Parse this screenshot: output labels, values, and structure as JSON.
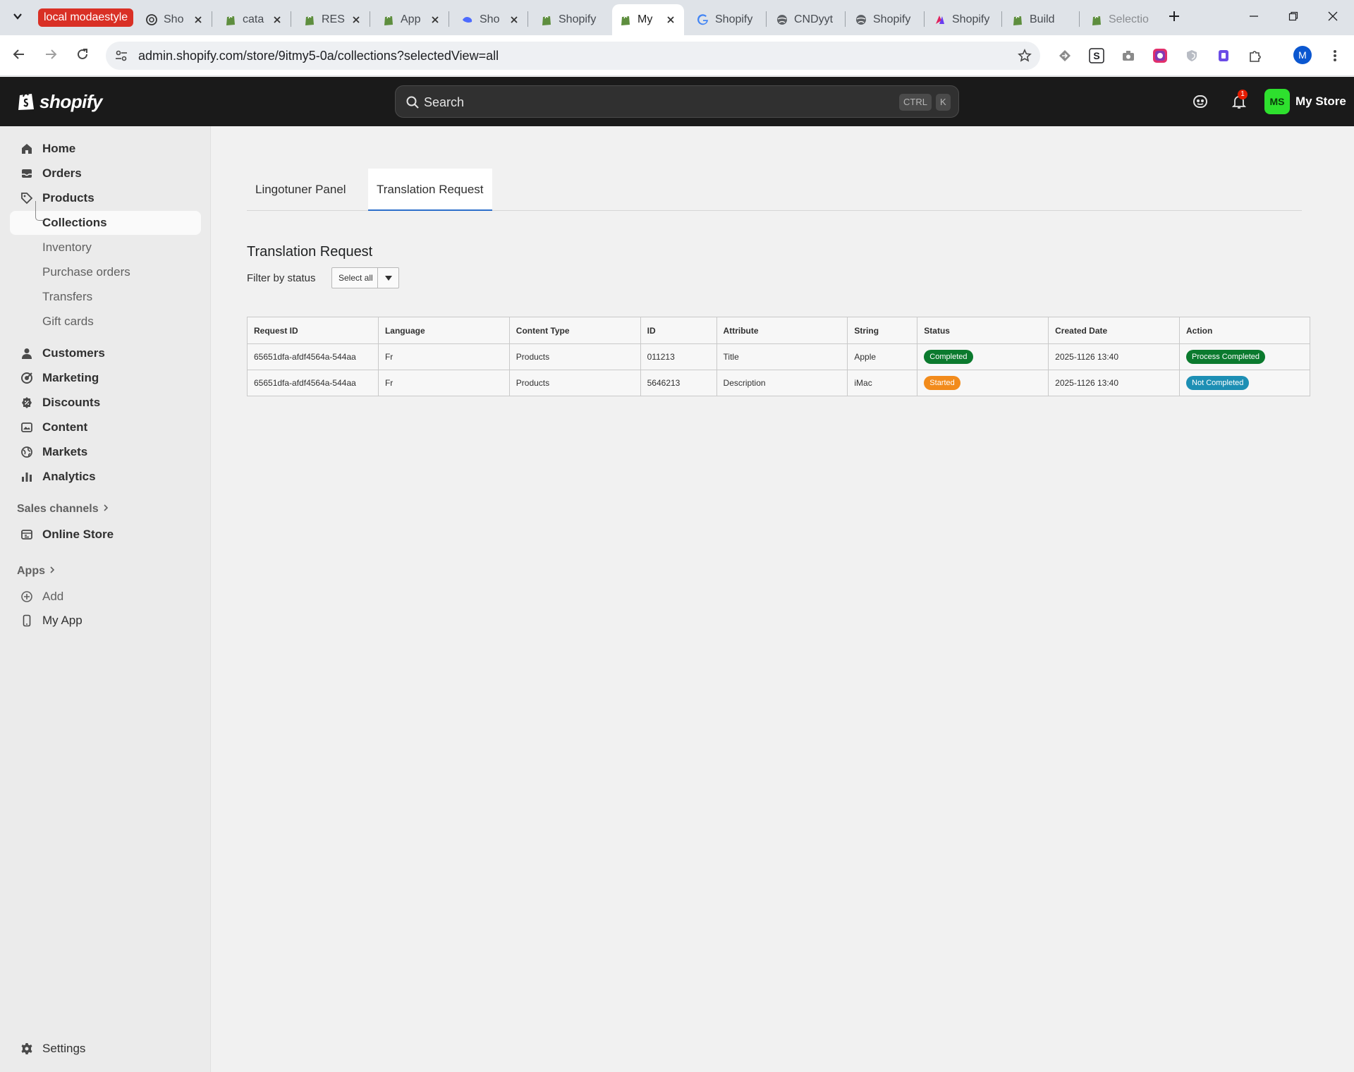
{
  "browser": {
    "tab_group_label": "local modaestyle",
    "tabs": [
      {
        "title": "Sho",
        "icon": "chatgpt-icon"
      },
      {
        "title": "cata",
        "icon": "shopify-bag-icon"
      },
      {
        "title": "RES",
        "icon": "shopify-bag-icon"
      },
      {
        "title": "App",
        "icon": "shopify-bag-icon"
      },
      {
        "title": "Sho",
        "icon": "deepseek-icon"
      },
      {
        "title": "Shopify",
        "icon": "shopify-bag-icon"
      },
      {
        "title": "My",
        "icon": "shopify-bag-icon"
      },
      {
        "title": "Shopify",
        "icon": "google-icon"
      },
      {
        "title": "CNDyyt",
        "icon": "globe-icon"
      },
      {
        "title": "Shopify",
        "icon": "globe-icon"
      },
      {
        "title": "Shopify",
        "icon": "app-icon"
      },
      {
        "title": "Build",
        "icon": "shopify-bag-icon"
      },
      {
        "title": "Selectio",
        "icon": "shopify-bag-icon"
      }
    ],
    "url": "admin.shopify.com/store/9itmy5-0a/collections?selectedView=all",
    "profile_initial": "M"
  },
  "topbar": {
    "logo_text": "shopify",
    "search_placeholder": "Search",
    "shortcut_ctrl": "CTRL",
    "shortcut_key": "K",
    "notification_count": "1",
    "store_initials": "MS",
    "store_name": "My Store"
  },
  "sidebar": {
    "items": [
      {
        "label": "Home",
        "icon": "home-icon"
      },
      {
        "label": "Orders",
        "icon": "inbox-icon"
      },
      {
        "label": "Products",
        "icon": "tag-icon"
      },
      {
        "label": "Collections"
      },
      {
        "label": "Inventory"
      },
      {
        "label": "Purchase orders"
      },
      {
        "label": "Transfers"
      },
      {
        "label": "Gift cards"
      },
      {
        "label": "Customers",
        "icon": "person-icon"
      },
      {
        "label": "Marketing",
        "icon": "target-icon"
      },
      {
        "label": "Discounts",
        "icon": "discount-icon"
      },
      {
        "label": "Content",
        "icon": "content-icon"
      },
      {
        "label": "Markets",
        "icon": "globe-icon"
      },
      {
        "label": "Analytics",
        "icon": "bar-chart-icon"
      }
    ],
    "sales_channels_label": "Sales channels",
    "online_store_label": "Online Store",
    "apps_label": "Apps",
    "add_label": "Add",
    "my_app_label": "My App",
    "settings_label": "Settings"
  },
  "main": {
    "tabs": [
      {
        "label": "Lingotuner Panel"
      },
      {
        "label": "Translation Request"
      }
    ],
    "title": "Translation Request",
    "filter_label": "Filter by status",
    "filter_value": "Select all",
    "table": {
      "headers": [
        "Request ID",
        "Language",
        "Content Type",
        "ID",
        "Attribute",
        "String",
        "Status",
        "Created Date",
        "Action"
      ],
      "rows": [
        {
          "request_id": "65651dfa-afdf4564a-544aa",
          "language": "Fr",
          "content_type": "Products",
          "id": "011213",
          "attribute": "Title",
          "string": "Apple",
          "status": "Completed",
          "created": "2025-1126 13:40",
          "action": "Process Completed"
        },
        {
          "request_id": "65651dfa-afdf4564a-544aa",
          "language": "Fr",
          "content_type": "Products",
          "id": "5646213",
          "attribute": "Description",
          "string": "iMac",
          "status": "Started",
          "created": "2025-1126 13:40",
          "action": "Not Completed"
        }
      ]
    }
  },
  "colors": {
    "completed_badge": "#0b7a2e",
    "started_badge": "#f28b1b",
    "process_completed_badge": "#0b7a2e",
    "not_completed_badge": "#1d8fb4",
    "active_tab_underline": "#2c6ecb",
    "topbar_bg": "#1a1a1a",
    "tab_group": "#d93025"
  }
}
